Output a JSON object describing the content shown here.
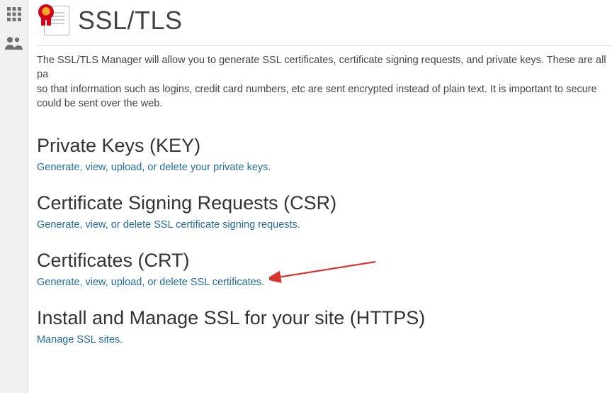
{
  "sidebar": {
    "items": [
      {
        "name": "apps-icon"
      },
      {
        "name": "users-icon"
      }
    ]
  },
  "header": {
    "title": "SSL/TLS",
    "icon": "ssl-certificate-icon"
  },
  "intro": "The SSL/TLS Manager will allow you to generate SSL certificates, certificate signing requests, and private keys. These are all pa\nso that information such as logins, credit card numbers, etc are sent encrypted instead of plain text. It is important to secure\ncould be sent over the web.",
  "sections": [
    {
      "heading": "Private Keys (KEY)",
      "link": "Generate, view, upload, or delete your private keys."
    },
    {
      "heading": "Certificate Signing Requests (CSR)",
      "link": "Generate, view, or delete SSL certificate signing requests."
    },
    {
      "heading": "Certificates (CRT)",
      "link": "Generate, view, upload, or delete SSL certificates."
    },
    {
      "heading": "Install and Manage SSL for your site (HTTPS)",
      "link": "Manage SSL sites."
    }
  ],
  "annotation": {
    "arrow_color": "#d9362f"
  }
}
